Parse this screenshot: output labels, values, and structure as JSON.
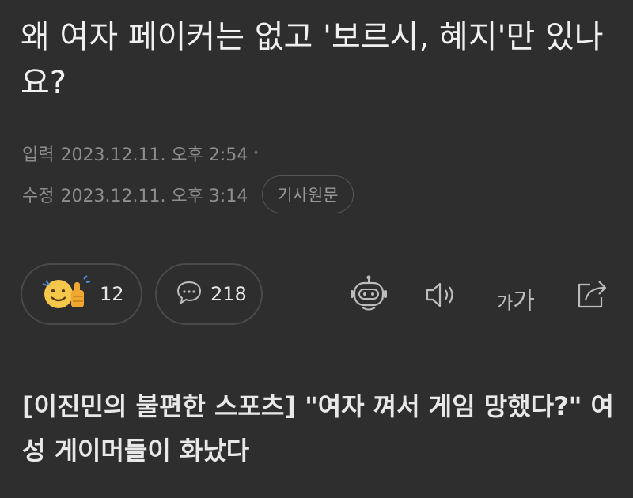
{
  "article": {
    "title": "왜 여자 페이커는 없고 '보르시, 혜지'만 있나요?",
    "input_label": "입력",
    "input_time": "2023.12.11. 오후 2:54",
    "modified_label": "수정",
    "modified_time": "2023.12.11. 오후 3:14",
    "original_button": "기사원문",
    "headline": "[이진민의 불편한 스포츠] \"여자 껴서 게임 망했다?\" 여성 게이머들이 화났다"
  },
  "reactions": {
    "like_count": "12",
    "comment_count": "218"
  },
  "toolbar": {
    "font_size_label": "가가",
    "font_small": "가",
    "font_big": "가"
  },
  "colors": {
    "background": "#2e2e2e",
    "text": "#f0f0f0",
    "meta": "#8e8e8e",
    "emoji": "#f5c84c"
  },
  "icons": [
    "smile-thumbsup-icon",
    "comment-icon",
    "robot-summary-icon",
    "speaker-icon",
    "font-size-icon",
    "share-icon"
  ]
}
